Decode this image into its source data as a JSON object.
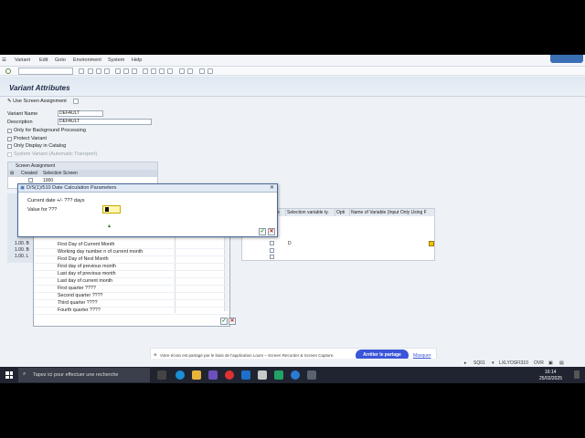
{
  "menu": {
    "items": [
      "Variant",
      "Edit",
      "Goto",
      "Environment",
      "System",
      "Help"
    ]
  },
  "page": {
    "title": "Variant Attributes",
    "use_screen_assignment": "Use Screen Assignment"
  },
  "fields": {
    "variant_name_label": "Variant Name",
    "variant_name_value": "DEFAULT",
    "description_label": "Description",
    "description_value": "DEFAULT",
    "only_background": "Only for Background Processing",
    "protect_variant": "Protect Variant",
    "only_display": "Only Display in Catalog",
    "system_variant": "System Variant (Automatic Transport)"
  },
  "screen_assignment": {
    "header": "Screen Assignment",
    "col_created": "Created",
    "col_selection_screen": "Selection Screen",
    "row_value": "1000"
  },
  "right_table": {
    "headers": [
      "ie",
      "Selection variable ty.",
      "Opti",
      "Name of Variable (Input Only Using F"
    ],
    "row_value": "D"
  },
  "left_rows": [
    "1.00. B",
    "1.00. B",
    "1.00. L"
  ],
  "dropdown": {
    "items": [
      "First Day of Current Month",
      "Working day number n of current month",
      "First Day of Next Month",
      "First day of previous month",
      "Last day of previous month",
      "Last day of current month",
      "First quarter ????",
      "Second quarter ????",
      "Third quarter ????",
      "Fourth quarter ????"
    ]
  },
  "popup": {
    "title": "D/S(1)/510 Date Calculation Parameters",
    "line1": "Current date +/- ??? days",
    "line2": "Value for ???"
  },
  "loom": {
    "text": "Votre écran est partagé par le biais de l'application Loom – Screen Recorder & Screen Capture.",
    "stop_label": "Arrêter le partage",
    "hide_label": "Masquer"
  },
  "status": {
    "system": "SQ01",
    "host": "LXLYOSFI310",
    "mode": "OVR"
  },
  "taskbar": {
    "search_placeholder": "Tapez ici pour effectuer une recherche",
    "time": "16:14",
    "date": "25/02/2025"
  },
  "colors": {
    "sap_blue": "#3a6fb4",
    "loom_blue": "#3a55d8",
    "taskbar": "#1f2430"
  }
}
